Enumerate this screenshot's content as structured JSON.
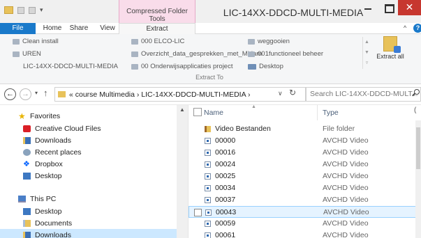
{
  "window": {
    "title": "LIC-14XX-DDCD-MULTI-MEDIA",
    "context_tab_group": "Compressed Folder Tools",
    "close_glyph": "✕"
  },
  "ribbon": {
    "tabs": [
      {
        "label": "File",
        "active": false
      },
      {
        "label": "Home",
        "active": false
      },
      {
        "label": "Share",
        "active": false
      },
      {
        "label": "View",
        "active": false
      },
      {
        "label": "Extract",
        "active": true
      }
    ],
    "extract_to_locations": [
      {
        "label": "Clean install"
      },
      {
        "label": "UREN"
      },
      {
        "label": "LIC-14XX-DDCD-MULTI-MEDIA"
      },
      {
        "label": "000 ELCO-LIC"
      },
      {
        "label": "Overzicht_data_gesprekken_met_Mirjam"
      },
      {
        "label": "00 Onderwijsapplicaties project"
      },
      {
        "label": "weggooien"
      },
      {
        "label": "001functioneel beheer"
      },
      {
        "label": "Desktop"
      }
    ],
    "group_label": "Extract To",
    "extract_all_label": "Extract all"
  },
  "address": {
    "path": "« course Multimedia  ›  LIC-14XX-DDCD-MULTI-MEDIA  ›",
    "search_placeholder": "Search LIC-14XX-DDCD-MULT..."
  },
  "nav_pane": {
    "items": [
      {
        "label": "Favorites",
        "icon": "star-icon",
        "level": 0
      },
      {
        "label": "Creative Cloud Files",
        "icon": "creative-cloud-icon",
        "level": 1
      },
      {
        "label": "Downloads",
        "icon": "downloads-folder-icon",
        "level": 1
      },
      {
        "label": "Recent places",
        "icon": "recent-places-icon",
        "level": 1
      },
      {
        "label": "Dropbox",
        "icon": "dropbox-icon",
        "level": 1
      },
      {
        "label": "Desktop",
        "icon": "desktop-icon",
        "level": 1
      },
      {
        "label": "This PC",
        "icon": "computer-icon",
        "level": 0
      },
      {
        "label": "Desktop",
        "icon": "desktop-folder-icon",
        "level": 1
      },
      {
        "label": "Documents",
        "icon": "documents-folder-icon",
        "level": 1
      },
      {
        "label": "Downloads",
        "icon": "downloads-folder-icon",
        "level": 1
      }
    ]
  },
  "file_list": {
    "columns": {
      "name": "Name",
      "type": "Type"
    },
    "rows": [
      {
        "name": "Video Bestanden",
        "type": "File folder",
        "kind": "folder"
      },
      {
        "name": "00000",
        "type": "AVCHD Video",
        "kind": "video"
      },
      {
        "name": "00016",
        "type": "AVCHD Video",
        "kind": "video"
      },
      {
        "name": "00024",
        "type": "AVCHD Video",
        "kind": "video"
      },
      {
        "name": "00025",
        "type": "AVCHD Video",
        "kind": "video"
      },
      {
        "name": "00034",
        "type": "AVCHD Video",
        "kind": "video"
      },
      {
        "name": "00037",
        "type": "AVCHD Video",
        "kind": "video"
      },
      {
        "name": "00043",
        "type": "AVCHD Video",
        "kind": "video",
        "hover": true
      },
      {
        "name": "00059",
        "type": "AVCHD Video",
        "kind": "video"
      },
      {
        "name": "00061",
        "type": "AVCHD Video",
        "kind": "video"
      }
    ]
  },
  "colors": {
    "file_tab": "#1979ca",
    "context_tab": "#f9dcea",
    "close_button": "#c7372f",
    "selection": "#cce8ff",
    "hover": "#e5f3ff"
  }
}
